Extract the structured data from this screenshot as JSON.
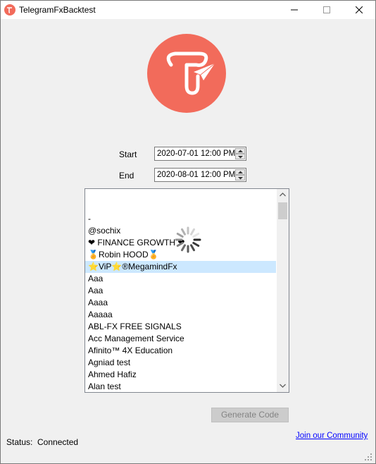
{
  "window": {
    "title": "TelegramFxBacktest"
  },
  "dates": {
    "start_label": "Start",
    "start_value": "2020-07-01 12:00 PM",
    "end_label": "End",
    "end_value": "2020-08-01 12:00 PM"
  },
  "list": {
    "items": [
      {
        "label": "-"
      },
      {
        "label": "@sochix"
      },
      {
        "label": "❤ FINANCE GROWTH ❤"
      },
      {
        "label": "🏅Robin HOOD🏅"
      },
      {
        "label": "⭐ViP⭐®MegamindFx",
        "selected": true
      },
      {
        "label": "Aaa"
      },
      {
        "label": "Aaa"
      },
      {
        "label": "Aaaa"
      },
      {
        "label": "Aaaaa"
      },
      {
        "label": "ABL-FX FREE SIGNALS"
      },
      {
        "label": "Acc Management Service"
      },
      {
        "label": "Afinito™ 4X Education"
      },
      {
        "label": "Agniad test"
      },
      {
        "label": "Ahmed Hafiz"
      },
      {
        "label": "Alan test"
      }
    ],
    "selected_color": "#cce8ff"
  },
  "generate_button": {
    "label": "Generate Code"
  },
  "status": {
    "label": "Status:",
    "value": "Connected"
  },
  "community_link": {
    "label": "Join our Community"
  },
  "colors": {
    "brand": "#f26b5b",
    "link": "#0000ff"
  }
}
